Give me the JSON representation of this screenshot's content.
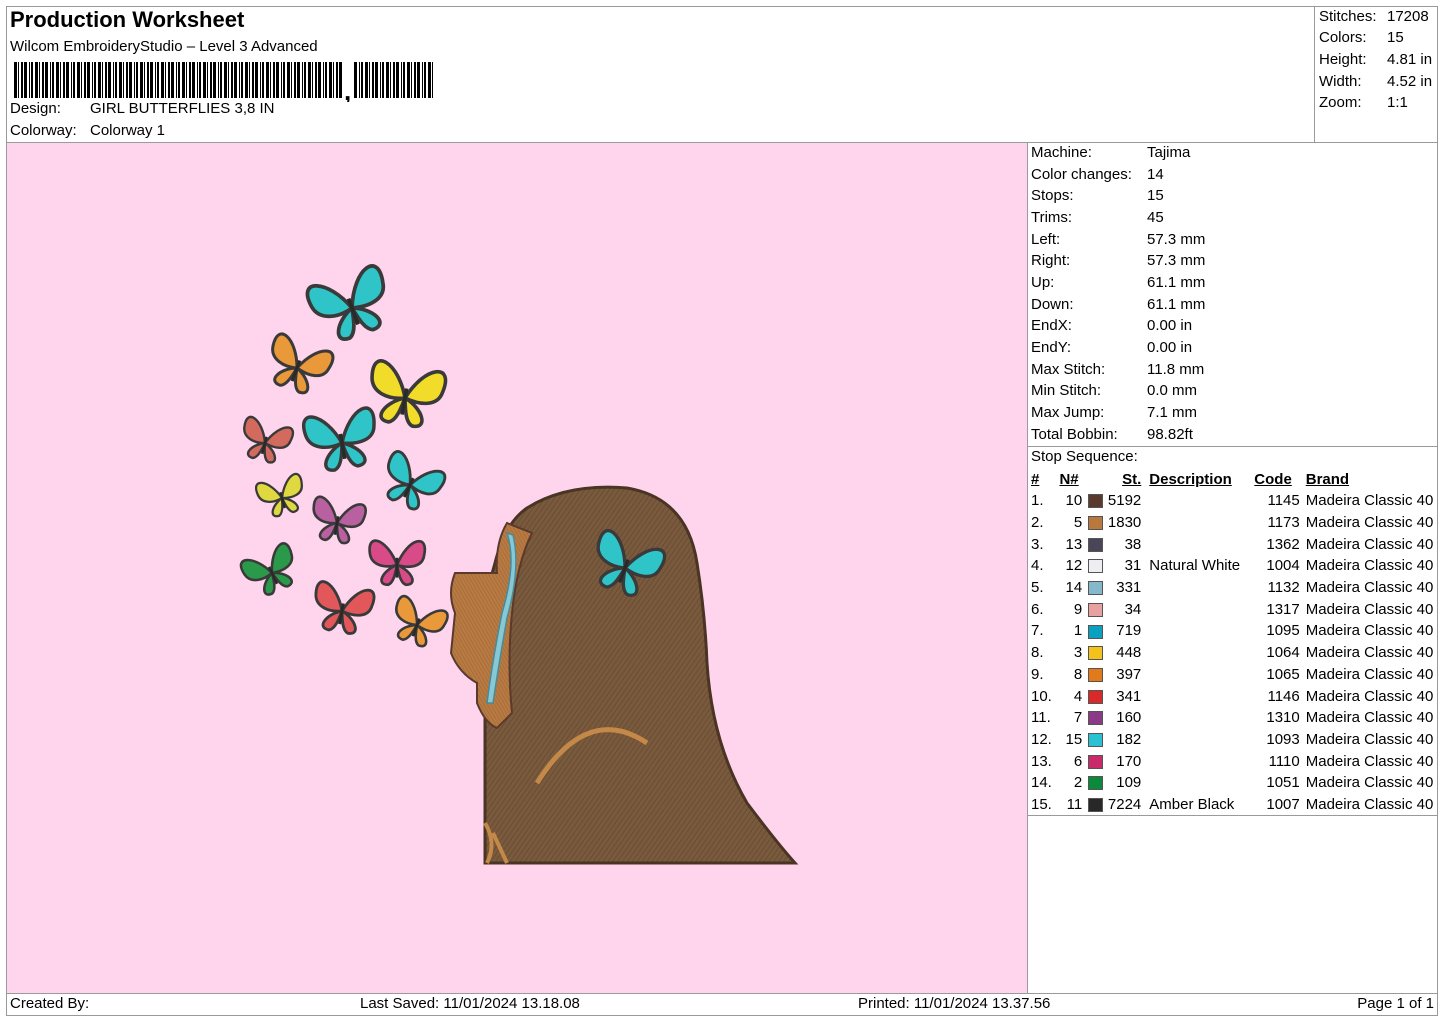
{
  "header": {
    "title": "Production Worksheet",
    "software": "Wilcom EmbroideryStudio – Level 3 Advanced",
    "design_label": "Design:",
    "design_value": "GIRL BUTTERFLIES 3,8 IN",
    "colorway_label": "Colorway:",
    "colorway_value": "Colorway 1"
  },
  "summary": [
    {
      "label": "Stitches:",
      "value": "17208"
    },
    {
      "label": "Colors:",
      "value": "15"
    },
    {
      "label": "Height:",
      "value": "4.81 in"
    },
    {
      "label": "Width:",
      "value": "4.52 in"
    },
    {
      "label": "Zoom:",
      "value": "1:1"
    }
  ],
  "machine_info": [
    {
      "label": "Machine:",
      "value": "Tajima"
    },
    {
      "label": "Color changes:",
      "value": "14"
    },
    {
      "label": "Stops:",
      "value": "15"
    },
    {
      "label": "Trims:",
      "value": "45"
    },
    {
      "label": "Left:",
      "value": "57.3 mm"
    },
    {
      "label": "Right:",
      "value": "57.3 mm"
    },
    {
      "label": "Up:",
      "value": "61.1 mm"
    },
    {
      "label": "Down:",
      "value": "61.1 mm"
    },
    {
      "label": "EndX:",
      "value": "0.00 in"
    },
    {
      "label": "EndY:",
      "value": "0.00 in"
    },
    {
      "label": "Max Stitch:",
      "value": "11.8 mm"
    },
    {
      "label": "Min Stitch:",
      "value": "0.0 mm"
    },
    {
      "label": "Max Jump:",
      "value": "7.1 mm"
    },
    {
      "label": "Total Bobbin:",
      "value": "98.82ft"
    }
  ],
  "stop_sequence": {
    "title": "Stop Sequence:",
    "columns": [
      "#",
      "N#",
      "St.",
      "Description",
      "Code",
      "Brand"
    ],
    "rows": [
      {
        "idx": "1.",
        "n": "10",
        "color": "#5a3a2c",
        "st": "5192",
        "desc": "",
        "code": "1145",
        "brand": "Madeira Classic 40"
      },
      {
        "idx": "2.",
        "n": "5",
        "color": "#b8783e",
        "st": "1830",
        "desc": "",
        "code": "1173",
        "brand": "Madeira Classic 40"
      },
      {
        "idx": "3.",
        "n": "13",
        "color": "#4a4658",
        "st": "38",
        "desc": "",
        "code": "1362",
        "brand": "Madeira Classic 40"
      },
      {
        "idx": "4.",
        "n": "12",
        "color": "#eeeef2",
        "st": "31",
        "desc": "Natural White",
        "code": "1004",
        "brand": "Madeira Classic 40"
      },
      {
        "idx": "5.",
        "n": "14",
        "color": "#86b8cc",
        "st": "331",
        "desc": "",
        "code": "1132",
        "brand": "Madeira Classic 40"
      },
      {
        "idx": "6.",
        "n": "9",
        "color": "#e9a0a0",
        "st": "34",
        "desc": "",
        "code": "1317",
        "brand": "Madeira Classic 40"
      },
      {
        "idx": "7.",
        "n": "1",
        "color": "#0aa0c0",
        "st": "719",
        "desc": "",
        "code": "1095",
        "brand": "Madeira Classic 40"
      },
      {
        "idx": "8.",
        "n": "3",
        "color": "#f5c21c",
        "st": "448",
        "desc": "",
        "code": "1064",
        "brand": "Madeira Classic 40"
      },
      {
        "idx": "9.",
        "n": "8",
        "color": "#e27a1c",
        "st": "397",
        "desc": "",
        "code": "1065",
        "brand": "Madeira Classic 40"
      },
      {
        "idx": "10.",
        "n": "4",
        "color": "#d82a28",
        "st": "341",
        "desc": "",
        "code": "1146",
        "brand": "Madeira Classic 40"
      },
      {
        "idx": "11.",
        "n": "7",
        "color": "#8a3a86",
        "st": "160",
        "desc": "",
        "code": "1310",
        "brand": "Madeira Classic 40"
      },
      {
        "idx": "12.",
        "n": "15",
        "color": "#2ac2d2",
        "st": "182",
        "desc": "",
        "code": "1093",
        "brand": "Madeira Classic 40"
      },
      {
        "idx": "13.",
        "n": "6",
        "color": "#c82a6a",
        "st": "170",
        "desc": "",
        "code": "1110",
        "brand": "Madeira Classic 40"
      },
      {
        "idx": "14.",
        "n": "2",
        "color": "#0a8a3a",
        "st": "109",
        "desc": "",
        "code": "1051",
        "brand": "Madeira Classic 40"
      },
      {
        "idx": "15.",
        "n": "11",
        "color": "#282828",
        "st": "7224",
        "desc": "Amber Black",
        "code": "1007",
        "brand": "Madeira Classic 40"
      }
    ]
  },
  "footer": {
    "created_by": "Created By:",
    "last_saved": "Last Saved: 11/01/2024 13.18.08",
    "printed": "Printed: 11/01/2024 13.37.56",
    "page": "Page 1 of 1"
  },
  "colors": {
    "preview_background": "#ffd5ee",
    "hood": "#7a5a3c",
    "skin": "#b87a42",
    "tear": "#86c8d4"
  }
}
